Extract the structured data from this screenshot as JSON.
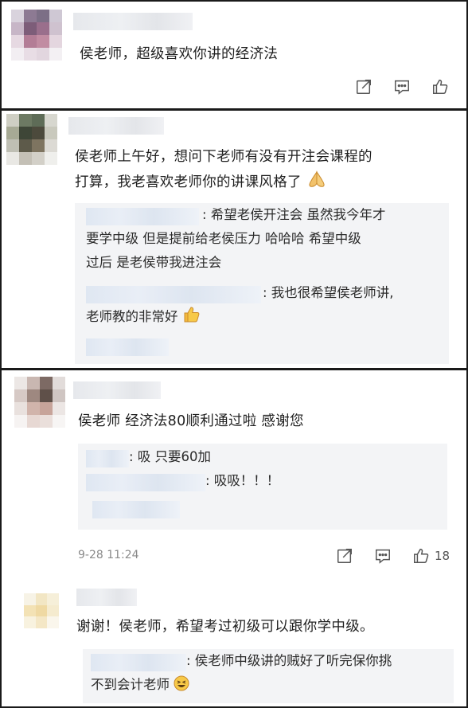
{
  "comments": [
    {
      "text": "侯老师，超级喜欢你讲的经济法"
    },
    {
      "text_line1": "侯老师上午好，想问下老师有没有开注会课程的",
      "text_line2": "打算，我老喜欢老师你的讲课风格了",
      "replies": [
        {
          "line1": ": 希望老侯开注会 虽然我今年才",
          "line2": "要学中级 但是提前给老侯压力 哈哈哈 希望中级",
          "line3": "过后 是老侯带我进注会"
        },
        {
          "line1": ": 我也很希望侯老师讲,",
          "line2": "老师教的非常好"
        }
      ]
    },
    {
      "text": "侯老师 经济法80顺利通过啦 感谢您",
      "replies": [
        {
          "text": ": 吸 只要60加"
        },
        {
          "text": ": 吸吸！！！"
        }
      ],
      "time": "9-28 11:24",
      "like_count": "18"
    },
    {
      "text": "谢谢！侯老师，希望考过初级可以跟你学中级。",
      "reply_line1": ": 侯老师中级讲的贼好了听完保你挑",
      "reply_line2": "不到会计老师"
    }
  ],
  "icons": [
    "share-icon",
    "comment-icon",
    "like-icon",
    "thumbs-up-emoji-icon",
    "folded-hands-emoji-icon",
    "laughing-emoji-icon"
  ],
  "colors": {
    "separator": "#1a1a1a",
    "reply_bg": "#f3f4f6",
    "muted_text": "#8a8a8a"
  }
}
